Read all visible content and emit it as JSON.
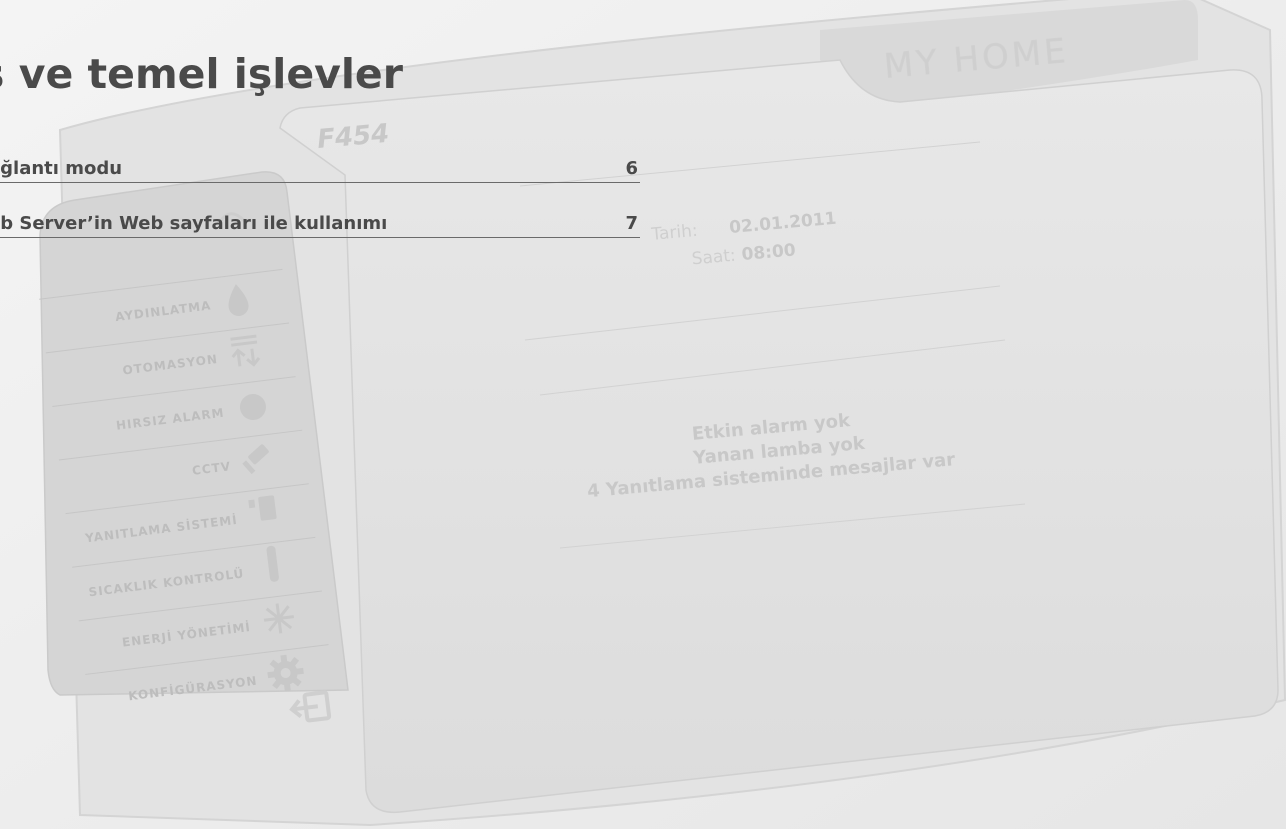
{
  "document": {
    "section_title": "ış ve temel işlevler",
    "toc": [
      {
        "label": "ağlantı modu",
        "page": "6"
      },
      {
        "label": "eb Server’in Web sayfaları ile kullanımı",
        "page": "7"
      }
    ]
  },
  "mockup": {
    "brand": "MY HOME",
    "device": "F454",
    "menu_items": [
      {
        "label": "AYDINLATMA",
        "icon": "drop-icon"
      },
      {
        "label": "OTOMASYON",
        "icon": "arrows-icon"
      },
      {
        "label": "HIRSIZ ALARM",
        "icon": "alarm-icon"
      },
      {
        "label": "CCTV",
        "icon": "camera-icon"
      },
      {
        "label": "YANITLAMA SİSTEMİ",
        "icon": "phone-icon"
      },
      {
        "label": "SICAKLIK KONTROLÜ",
        "icon": "thermometer-icon"
      },
      {
        "label": "ENERJİ YÖNETİMİ",
        "icon": "energy-icon"
      },
      {
        "label": "KONFİGÜRASYON",
        "icon": "gear-icon"
      }
    ],
    "date_label": "Tarih:",
    "date_value": "02.01.2011",
    "time_label": "Saat:",
    "time_value": "08:00",
    "status": [
      "Etkin alarm yok",
      "Yanan lamba yok",
      "4 Yanıtlama sisteminde mesajlar var"
    ]
  },
  "colors": {
    "text": "#4a4a4a",
    "mock_text": "#c8c8c8",
    "panel": "#e0e0e0",
    "sidebar": "#d6d6d6"
  }
}
